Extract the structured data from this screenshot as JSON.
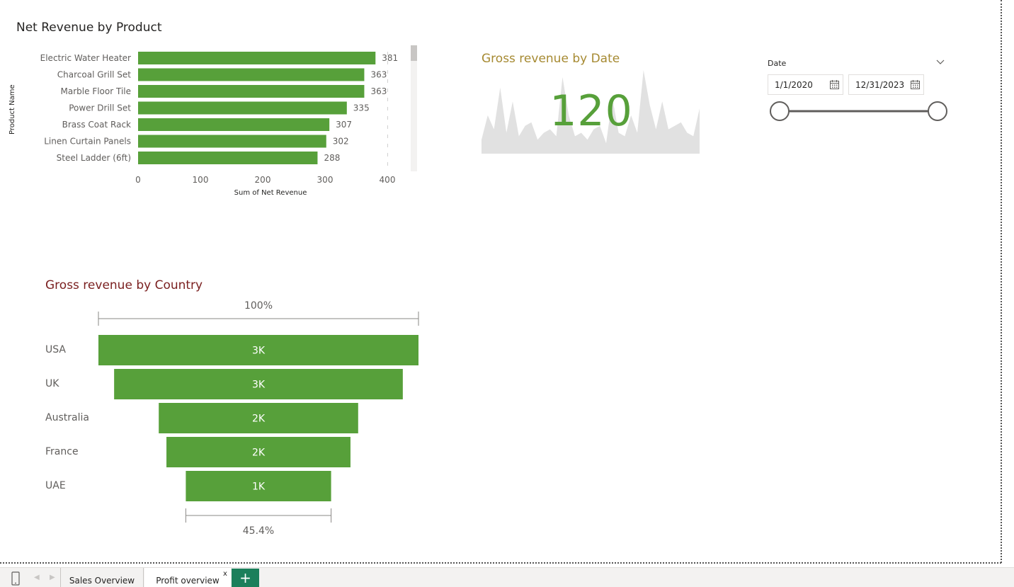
{
  "colors": {
    "bar": "#57a03a",
    "kpi_value": "#57a03a",
    "kpi_title": "#a68a32",
    "funnel_title": "#7a1f1f",
    "sparkline_area": "#e1e1e1",
    "add_page_button": "#1b7f5b"
  },
  "bar_visual": {
    "title": "Net Revenue by Product",
    "ylabel": "Product Name",
    "xlabel": "Sum of Net Revenue"
  },
  "kpi": {
    "title": "Gross revenue by Date",
    "value": "120"
  },
  "slicer": {
    "label": "Date",
    "start": "1/1/2020",
    "end": "12/31/2023",
    "chevron_icon": "chevron-down-icon",
    "calendar_icon": "calendar-icon"
  },
  "funnel_visual": {
    "title": "Gross revenue by Country",
    "top_label": "100%",
    "bottom_label": "45.4%"
  },
  "tabs": {
    "items": [
      "Sales Overview",
      "Profit overview"
    ],
    "close_label": "x",
    "add_label": "+",
    "mobile_icon": "mobile-layout-icon"
  },
  "chart_data": [
    {
      "type": "bar",
      "orientation": "horizontal",
      "title": "Net Revenue by Product",
      "xlabel": "Sum of Net Revenue",
      "ylabel": "Product Name",
      "categories": [
        "Electric Water Heater",
        "Charcoal Grill Set",
        "Marble Floor Tile",
        "Power Drill Set",
        "Brass Coat Rack",
        "Linen Curtain Panels",
        "Steel Ladder (6ft)"
      ],
      "values": [
        381,
        363,
        363,
        335,
        307,
        302,
        288
      ],
      "data_labels": [
        "381",
        "363",
        "363",
        "335",
        "307",
        "302",
        "288"
      ],
      "xlim": [
        0,
        400
      ],
      "xticks": [
        0,
        100,
        200,
        300,
        400
      ],
      "xtick_labels": [
        "0",
        "100",
        "200",
        "300",
        "400"
      ],
      "grid": false
    },
    {
      "type": "area",
      "title": "Gross revenue by Date",
      "values": [
        20,
        55,
        35,
        95,
        30,
        75,
        25,
        40,
        45,
        20,
        30,
        35,
        25,
        110,
        55,
        25,
        30,
        20,
        35,
        40,
        15,
        80,
        30,
        25,
        55,
        30,
        120,
        70,
        35,
        75,
        35,
        40,
        45,
        30,
        25,
        65
      ],
      "axes_visible": false
    },
    {
      "type": "funnel",
      "title": "Gross revenue by Country",
      "categories": [
        "USA",
        "UK",
        "Australia",
        "France",
        "UAE"
      ],
      "values": [
        1,
        0.902,
        0.623,
        0.575,
        0.454
      ],
      "data_labels": [
        "3K",
        "3K",
        "2K",
        "2K",
        "1K"
      ],
      "top_label": "100%",
      "bottom_label": "45.4%"
    }
  ]
}
